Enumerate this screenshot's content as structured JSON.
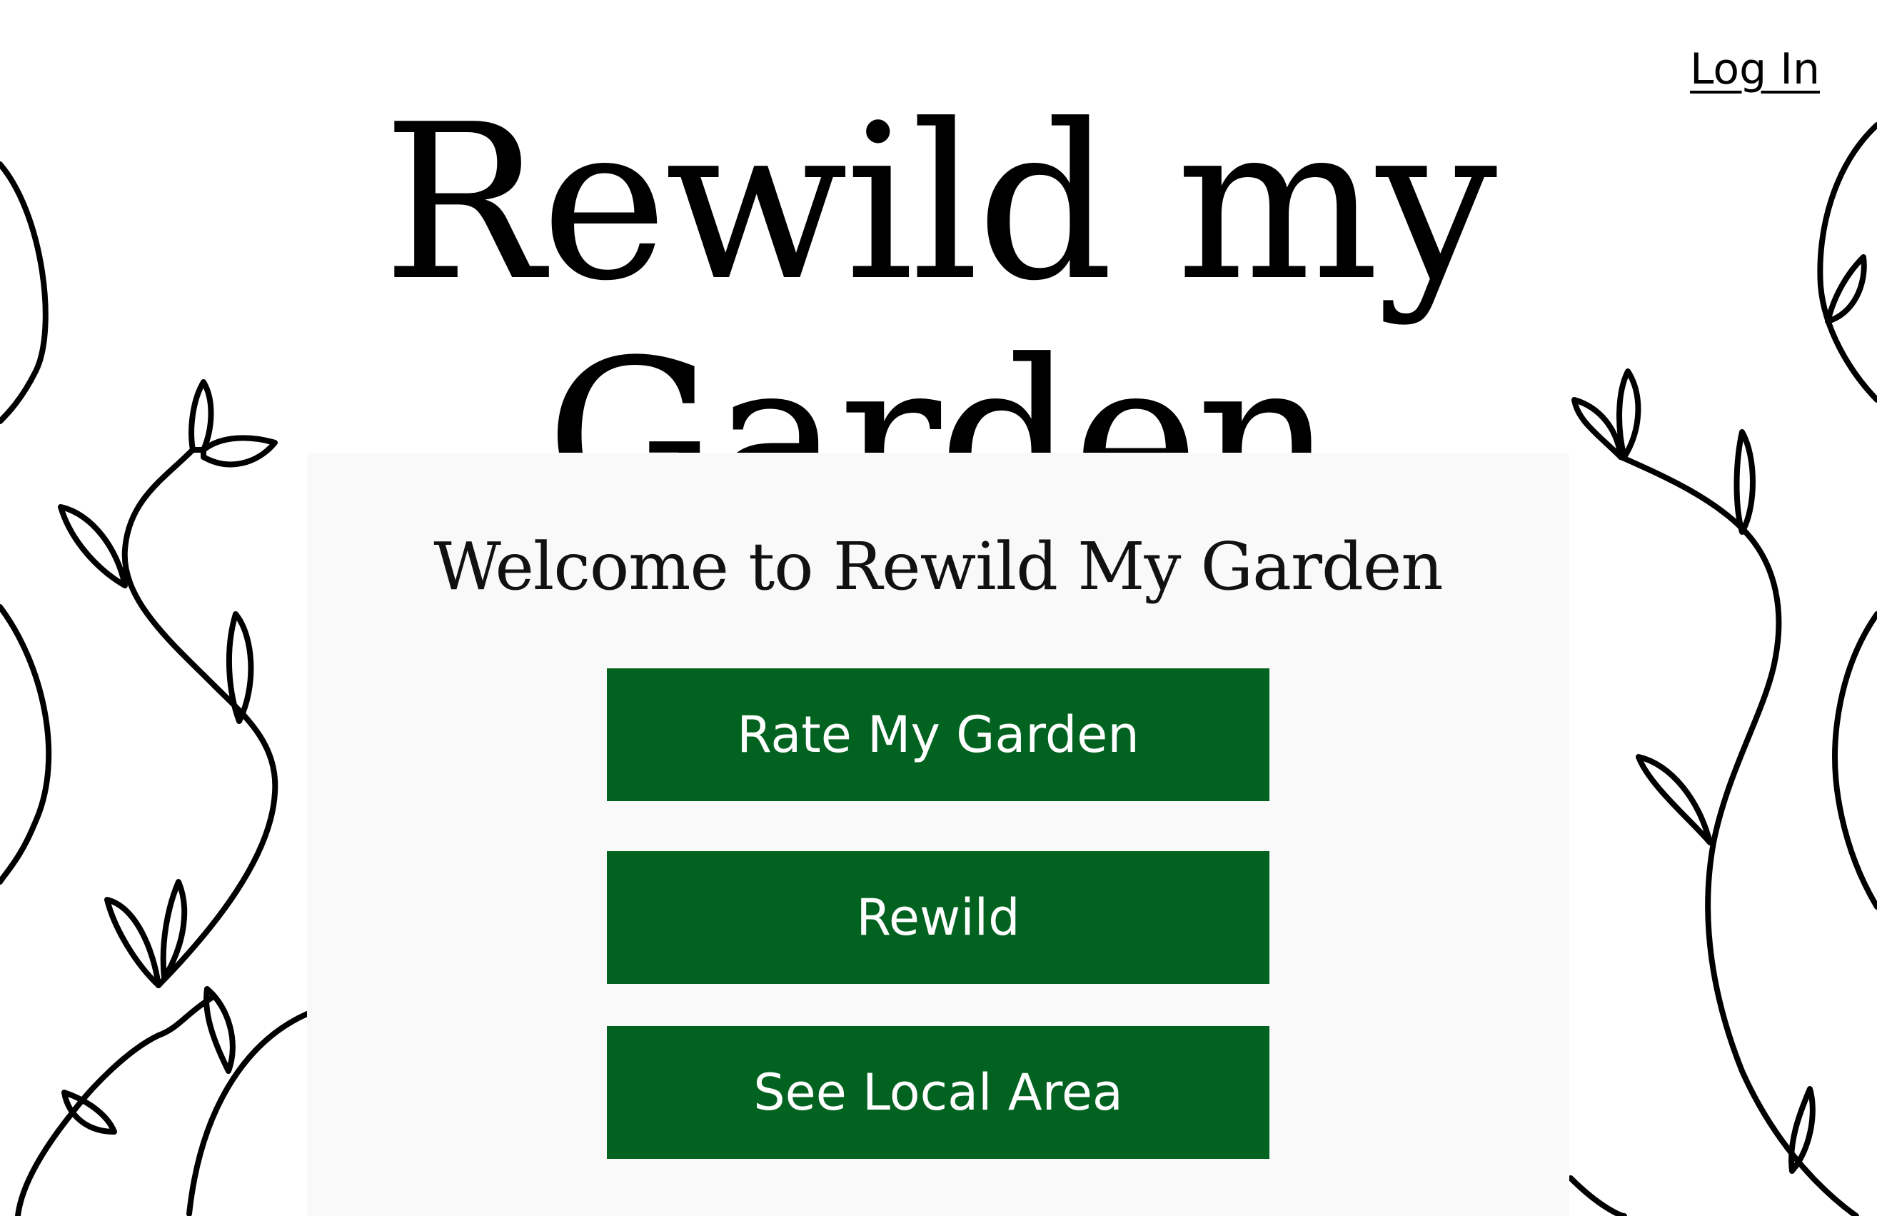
{
  "header": {
    "login_label": "Log In",
    "site_title": "Rewild my Garden"
  },
  "main": {
    "welcome_heading": "Welcome to Rewild My Garden",
    "buttons": [
      {
        "label": "Rate My Garden"
      },
      {
        "label": "Rewild"
      },
      {
        "label": "See Local Area"
      }
    ]
  },
  "decor": {
    "vine_icon": "vine-illustration"
  },
  "colors": {
    "button_bg": "#026220",
    "button_text": "#ffffff",
    "panel_bg": "#f9f9f9",
    "page_bg": "#ffffff",
    "text": "#000000"
  }
}
